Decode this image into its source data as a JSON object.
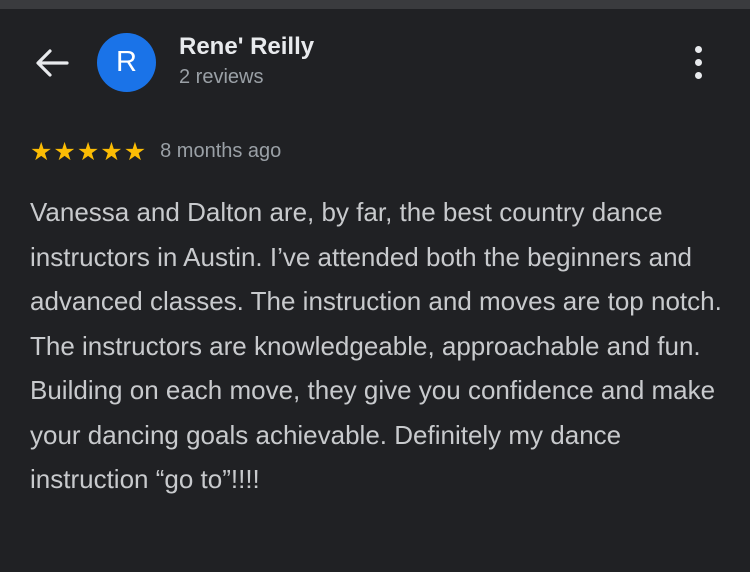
{
  "header": {
    "back_icon": "arrow-left-icon",
    "avatar_letter": "R",
    "avatar_color": "#1a73e8",
    "reviewer_name": "Rene' Reilly",
    "review_count": "2 reviews",
    "menu_icon": "more-vertical-icon"
  },
  "review": {
    "rating": 5,
    "max_rating": 5,
    "star_color": "#fbbc04",
    "time_ago": "8 months ago",
    "text": "Vanessa and Dalton are, by far, the best country dance instructors in Austin. I’ve attended both the beginners and advanced classes. The instruction and moves are top notch. The instructors are knowledgeable, approachable and fun. Building on each move, they give you confidence and make your dancing goals achievable. Definitely my dance instruction “go to”!!!!"
  }
}
